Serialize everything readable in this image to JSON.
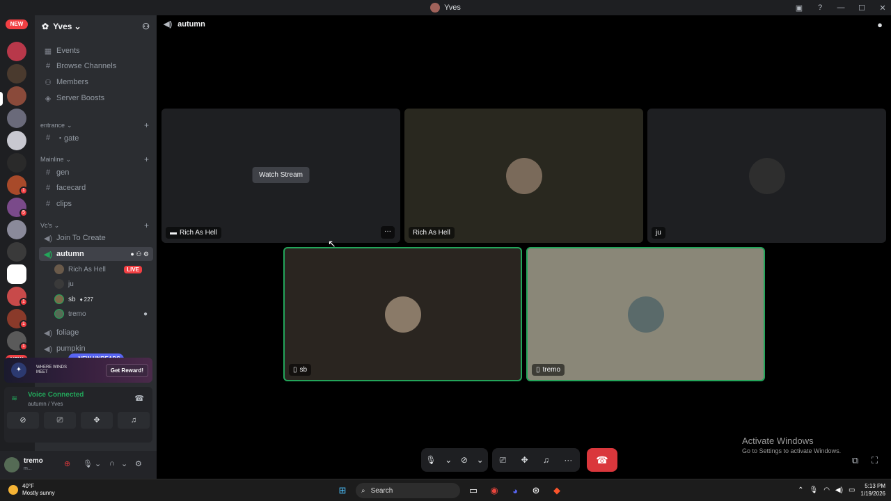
{
  "window": {
    "title": "Yves"
  },
  "titlebar_icons": [
    "inbox-icon",
    "help-icon",
    "minimize-icon",
    "maximize-icon",
    "close-icon"
  ],
  "guild_badges": {
    "new_top": "NEW",
    "new_bottom": "NEW",
    "b1": "1",
    "b2": "1",
    "b3": "5",
    "b4": "1",
    "b5": "1",
    "b6": "1"
  },
  "server": {
    "name": "Yves",
    "menu": [
      {
        "label": "Events",
        "icon": "calendar-icon"
      },
      {
        "label": "Browse Channels",
        "icon": "hashtag-icon"
      },
      {
        "label": "Members",
        "icon": "members-icon"
      },
      {
        "label": "Server Boosts",
        "icon": "boost-icon"
      }
    ],
    "categories": [
      {
        "name": "entrance",
        "channels": [
          "・gate"
        ]
      },
      {
        "name": "Mainline",
        "channels": [
          "gen",
          "facecard",
          "clips"
        ]
      },
      {
        "name": "Vc's",
        "channels": [
          "Join To Create",
          "autumn",
          "foliage",
          "pumpkin"
        ]
      }
    ],
    "voice_users": [
      {
        "name": "Rich As Hell",
        "badge": "LIVE"
      },
      {
        "name": "ju"
      },
      {
        "name": "sb",
        "extra": "227"
      },
      {
        "name": "tremo"
      }
    ],
    "new_unreads": "NEW UNREADS"
  },
  "promo": {
    "text": "WHERE WINDS MEET",
    "button": "Get Reward!"
  },
  "voice_panel": {
    "status": "Voice Connected",
    "sub": "autumn / Yves"
  },
  "user": {
    "name": "tremo",
    "status": "m..."
  },
  "channel": {
    "name": "autumn"
  },
  "tiles": {
    "t1": {
      "name": "Rich As Hell",
      "watch": "Watch Stream",
      "more": "···"
    },
    "t2": {
      "name": "Rich As Hell"
    },
    "t3": {
      "name": "ju"
    },
    "t4": {
      "name": "sb"
    },
    "t5": {
      "name": "tremo"
    }
  },
  "activation": {
    "title": "Activate Windows",
    "sub": "Go to Settings to activate Windows."
  },
  "taskbar": {
    "temp": "40°F",
    "weather": "Mostly sunny",
    "search": "Search",
    "time": "5:13 PM",
    "date": "1/19/2026"
  },
  "colors": {
    "green": "#23a55a",
    "red": "#da373c",
    "blurple": "#5865f2"
  }
}
